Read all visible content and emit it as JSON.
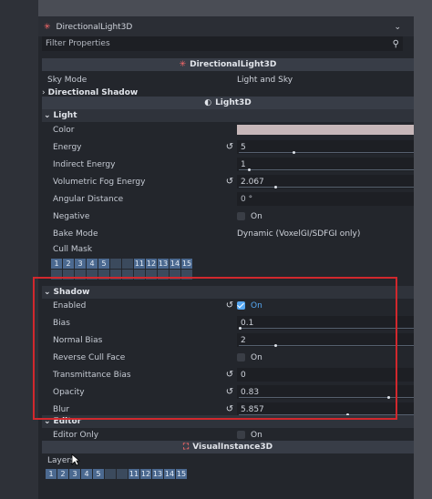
{
  "header": {
    "node_name": "DirectionalLight3D",
    "filter_placeholder": "Filter Properties"
  },
  "class_headers": {
    "directional": "DirectionalLight3D",
    "light3d": "Light3D",
    "visual": "VisualInstance3D"
  },
  "sky_mode": {
    "label": "Sky Mode",
    "value": "Light and Sky"
  },
  "sections": {
    "directional_shadow": "Directional Shadow",
    "light": "Light",
    "shadow": "Shadow",
    "editor": "Editor"
  },
  "light": {
    "color": {
      "label": "Color",
      "swatch": "#c7b7b9"
    },
    "energy": {
      "label": "Energy",
      "value": "5",
      "ratio": 0.3
    },
    "indirect_energy": {
      "label": "Indirect Energy",
      "value": "1",
      "ratio": 0.05
    },
    "vol_fog": {
      "label": "Volumetric Fog Energy",
      "value": "2.067",
      "ratio": 0.2
    },
    "angular": {
      "label": "Angular Distance",
      "value": "0 °"
    },
    "negative": {
      "label": "Negative",
      "value": "On"
    },
    "bake": {
      "label": "Bake Mode",
      "value": "Dynamic (VoxelGI/SDFGI only)"
    },
    "cull": {
      "label": "Cull Mask"
    }
  },
  "cull_layers": [
    "1",
    "2",
    "3",
    "4",
    "5",
    "",
    "",
    "11",
    "12",
    "13",
    "14",
    "15"
  ],
  "cull_layers_row2": [
    "",
    "",
    "",
    "",
    "",
    "",
    "",
    "",
    "",
    "",
    "",
    ""
  ],
  "shadow": {
    "enabled": {
      "label": "Enabled",
      "value": "On"
    },
    "bias": {
      "label": "Bias",
      "value": "0.1",
      "ratio": 0.0
    },
    "normal_bias": {
      "label": "Normal Bias",
      "value": "2",
      "ratio": 0.2
    },
    "reverse": {
      "label": "Reverse Cull Face",
      "value": "On"
    },
    "trans_bias": {
      "label": "Transmittance Bias",
      "value": "0"
    },
    "opacity": {
      "label": "Opacity",
      "value": "0.83",
      "ratio": 0.83
    },
    "blur": {
      "label": "Blur",
      "value": "5.857",
      "ratio": 0.6
    }
  },
  "editor": {
    "editor_only": {
      "label": "Editor Only",
      "value": "On"
    }
  },
  "visual": {
    "layers_label": "Layers"
  },
  "vis_layers": [
    "1",
    "2",
    "3",
    "4",
    "5",
    "",
    "",
    "11",
    "12",
    "13",
    "14",
    "15"
  ],
  "colors": {
    "accent": "#56a7f2",
    "highlight_box": "#d1282d"
  }
}
